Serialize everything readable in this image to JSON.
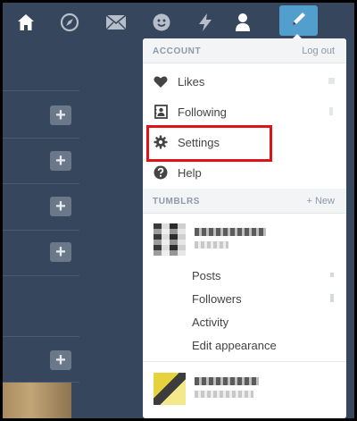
{
  "nav": {
    "icons": [
      "home-icon",
      "explore-compass-icon",
      "inbox-envelope-icon",
      "messaging-face-icon",
      "activity-lightning-icon",
      "account-person-icon"
    ],
    "compose_icon": "pencil-icon",
    "compose_color": "#529ecc"
  },
  "account_menu": {
    "header": "ACCOUNT",
    "logout": "Log out",
    "items": [
      {
        "label": "Likes",
        "icon": "heart-icon"
      },
      {
        "label": "Following",
        "icon": "following-badge-icon"
      },
      {
        "label": "Settings",
        "icon": "gear-icon"
      },
      {
        "label": "Help",
        "icon": "help-icon"
      }
    ],
    "highlight_color": "#e01317"
  },
  "tumblrs": {
    "header": "TUMBLRS",
    "new_link": "+ New",
    "primary_blog_links": [
      "Posts",
      "Followers",
      "Activity",
      "Edit appearance"
    ]
  },
  "dashboard": {
    "add_button_glyph": "+"
  },
  "colors": {
    "background": "#36465d",
    "menu_text": "#444444",
    "section_text": "#8d99a7"
  }
}
